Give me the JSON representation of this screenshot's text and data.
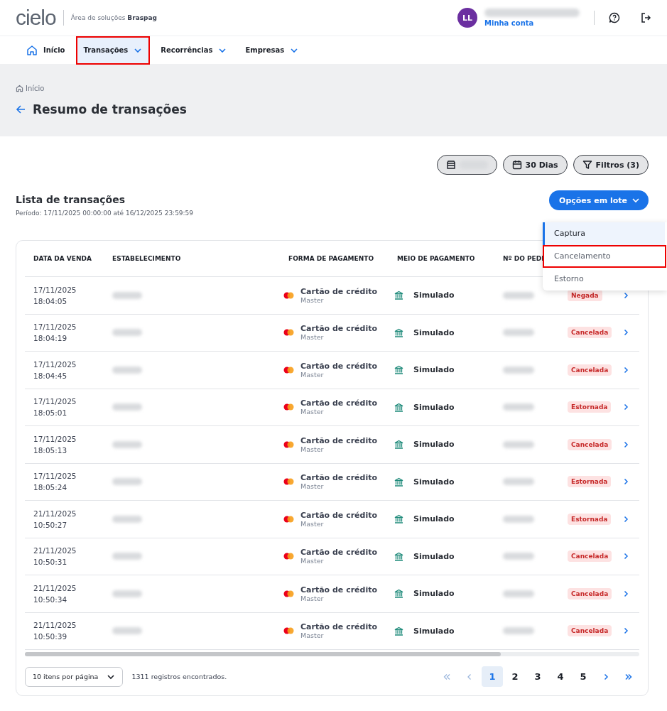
{
  "header": {
    "logo": "cielo",
    "subtitle_prefix": "Área de soluções",
    "subtitle_brand": "Braspag",
    "avatar": "LL",
    "account_link": "Minha conta"
  },
  "nav": [
    {
      "label": "Início",
      "kind": "home",
      "highlighted": false
    },
    {
      "label": "Transações",
      "kind": "menu",
      "highlighted": true
    },
    {
      "label": "Recorrências",
      "kind": "menu",
      "highlighted": false
    },
    {
      "label": "Empresas",
      "kind": "menu",
      "highlighted": false
    }
  ],
  "breadcrumb": "Início",
  "page_title": "Resumo de transações",
  "filters": [
    {
      "kind": "store"
    },
    {
      "kind": "calendar",
      "label": "30 Dias"
    },
    {
      "kind": "filter",
      "label": "Filtros (3)"
    }
  ],
  "list": {
    "title": "Lista de transações",
    "period": "Período: 17/11/2025 00:00:00 até 16/12/2025 23:59:59"
  },
  "batch_button": "Opções em lote",
  "batch_menu": [
    {
      "label": "Captura",
      "selected": true,
      "highlighted": false
    },
    {
      "label": "Cancelamento",
      "selected": false,
      "highlighted": true
    },
    {
      "label": "Estorno",
      "selected": false,
      "highlighted": false
    }
  ],
  "table": {
    "columns": [
      "DATA DA VENDA",
      "ESTABELECIMENTO",
      "FORMA DE PAGAMENTO",
      "MEIO DE PAGAMENTO",
      "Nº DO PEDI"
    ],
    "rows": [
      {
        "date": "17/11/2025",
        "time": "18:04:05",
        "payment": "Cartão de crédito",
        "brand": "Master",
        "means": "Simulado",
        "status": "Negada"
      },
      {
        "date": "17/11/2025",
        "time": "18:04:19",
        "payment": "Cartão de crédito",
        "brand": "Master",
        "means": "Simulado",
        "status": "Cancelada"
      },
      {
        "date": "17/11/2025",
        "time": "18:04:45",
        "payment": "Cartão de crédito",
        "brand": "Master",
        "means": "Simulado",
        "status": "Cancelada"
      },
      {
        "date": "17/11/2025",
        "time": "18:05:01",
        "payment": "Cartão de crédito",
        "brand": "Master",
        "means": "Simulado",
        "status": "Estornada"
      },
      {
        "date": "17/11/2025",
        "time": "18:05:13",
        "payment": "Cartão de crédito",
        "brand": "Master",
        "means": "Simulado",
        "status": "Cancelada"
      },
      {
        "date": "17/11/2025",
        "time": "18:05:24",
        "payment": "Cartão de crédito",
        "brand": "Master",
        "means": "Simulado",
        "status": "Estornada"
      },
      {
        "date": "21/11/2025",
        "time": "10:50:27",
        "payment": "Cartão de crédito",
        "brand": "Master",
        "means": "Simulado",
        "status": "Estornada"
      },
      {
        "date": "21/11/2025",
        "time": "10:50:31",
        "payment": "Cartão de crédito",
        "brand": "Master",
        "means": "Simulado",
        "status": "Cancelada"
      },
      {
        "date": "21/11/2025",
        "time": "10:50:34",
        "payment": "Cartão de crédito",
        "brand": "Master",
        "means": "Simulado",
        "status": "Cancelada"
      },
      {
        "date": "21/11/2025",
        "time": "10:50:39",
        "payment": "Cartão de crédito",
        "brand": "Master",
        "means": "Simulado",
        "status": "Cancelada"
      }
    ]
  },
  "footer": {
    "page_size": "10 itens por página",
    "records": "1311 registros encontrados.",
    "pages": [
      {
        "label": "1",
        "selected": true
      },
      {
        "label": "2",
        "selected": false
      },
      {
        "label": "3",
        "selected": false
      },
      {
        "label": "4",
        "selected": false
      },
      {
        "label": "5",
        "selected": false
      }
    ]
  }
}
